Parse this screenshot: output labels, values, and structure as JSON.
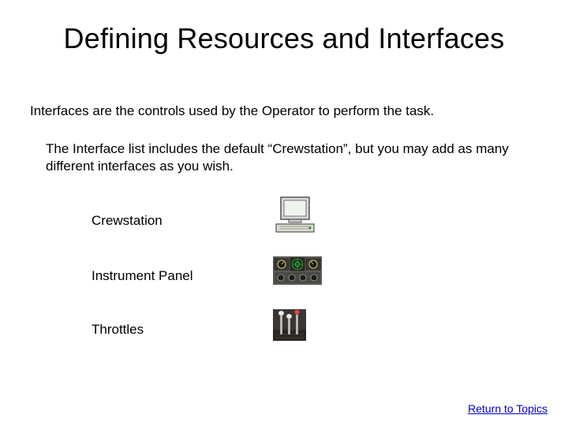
{
  "title": "Defining Resources and Interfaces",
  "intro": "Interfaces are the controls used by the Operator to perform the task.",
  "desc": "The Interface list includes the default “Crewstation”, but you may add as many different interfaces as you wish.",
  "items": [
    {
      "label": "Crewstation",
      "icon": "computer-icon"
    },
    {
      "label": "Instrument Panel",
      "icon": "instrument-panel-icon"
    },
    {
      "label": "Throttles",
      "icon": "throttles-icon"
    }
  ],
  "link": "Return to Topics"
}
